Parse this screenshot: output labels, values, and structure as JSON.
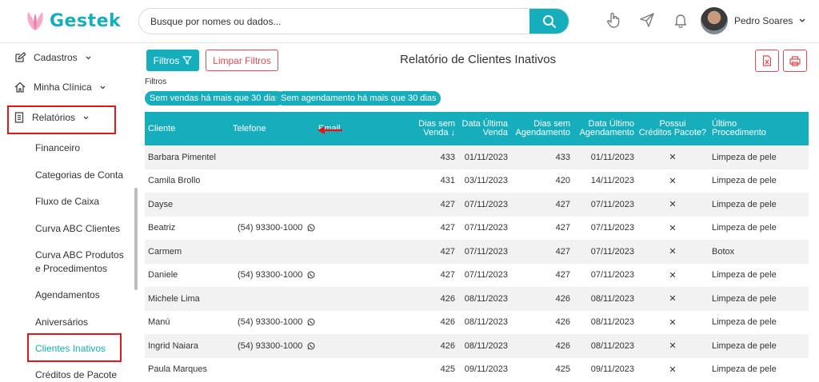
{
  "brand": {
    "name": "Gestek"
  },
  "search": {
    "placeholder": "Busque por nomes ou dados..."
  },
  "user": {
    "name": "Pedro Soares"
  },
  "colors": {
    "accent": "#16aebd",
    "danger": "#e04a55",
    "highlight": "#e01818"
  },
  "sidebar": {
    "cadastros": "Cadastros",
    "minha_clinica": "Minha Clínica",
    "relatorios": "Relatórios",
    "items": [
      "Financeiro",
      "Categorias de Conta",
      "Fluxo de Caixa",
      "Curva ABC Clientes",
      "Curva ABC Produtos e Procedimentos",
      "Agendamentos",
      "Aniversários",
      "Clientes Inativos",
      "Créditos de Pacote"
    ],
    "active_item": "Clientes Inativos"
  },
  "toolbar": {
    "filtros_label": "Filtros",
    "limpar_label": "Limpar Filtros",
    "title": "Relatório de Clientes Inativos"
  },
  "filters": {
    "label": "Filtros",
    "chips": [
      "Sem vendas há mais que 30 dias",
      "Sem agendamento há mais que 30 dias"
    ]
  },
  "table": {
    "headers": {
      "cliente": "Cliente",
      "telefone": "Telefone",
      "email": "Email",
      "dias_venda_1": "Dias sem",
      "dias_venda_2": "Venda",
      "data_venda_1": "Data Última",
      "data_venda_2": "Venda",
      "dias_agend_1": "Dias sem",
      "dias_agend_2": "Agendamento",
      "data_agend_1": "Data Último",
      "data_agend_2": "Agendamento",
      "creditos_1": "Possui",
      "creditos_2": "Créditos Pacote?",
      "proc_1": "Último",
      "proc_2": "Procedimento"
    },
    "rows": [
      {
        "cliente": "Barbara Pimentel",
        "telefone": "",
        "dias_venda": "433",
        "data_venda": "01/11/2023",
        "dias_agend": "433",
        "data_agend": "01/11/2023",
        "creditos": "✕",
        "procedimento": "Limpeza de pele"
      },
      {
        "cliente": "Camila Brollo",
        "telefone": "",
        "dias_venda": "431",
        "data_venda": "03/11/2023",
        "dias_agend": "420",
        "data_agend": "14/11/2023",
        "creditos": "✕",
        "procedimento": "Limpeza de pele"
      },
      {
        "cliente": "Dayse",
        "telefone": "",
        "dias_venda": "427",
        "data_venda": "07/11/2023",
        "dias_agend": "427",
        "data_agend": "07/11/2023",
        "creditos": "✕",
        "procedimento": "Limpeza de pele"
      },
      {
        "cliente": "Beatriz",
        "telefone": "(54) 93300-1000",
        "dias_venda": "427",
        "data_venda": "07/11/2023",
        "dias_agend": "427",
        "data_agend": "07/11/2023",
        "creditos": "✕",
        "procedimento": "Limpeza de pele"
      },
      {
        "cliente": "Carmem",
        "telefone": "",
        "dias_venda": "427",
        "data_venda": "07/11/2023",
        "dias_agend": "427",
        "data_agend": "07/11/2023",
        "creditos": "✕",
        "procedimento": "Botox"
      },
      {
        "cliente": "Daniele",
        "telefone": "(54) 93300-1000",
        "dias_venda": "427",
        "data_venda": "07/11/2023",
        "dias_agend": "427",
        "data_agend": "07/11/2023",
        "creditos": "✕",
        "procedimento": "Limpeza de pele"
      },
      {
        "cliente": "Michele Lima",
        "telefone": "",
        "dias_venda": "426",
        "data_venda": "08/11/2023",
        "dias_agend": "426",
        "data_agend": "08/11/2023",
        "creditos": "✕",
        "procedimento": "Limpeza de pele"
      },
      {
        "cliente": "Manú",
        "telefone": "(54) 93300-1000",
        "dias_venda": "426",
        "data_venda": "08/11/2023",
        "dias_agend": "426",
        "data_agend": "08/11/2023",
        "creditos": "✕",
        "procedimento": "Limpeza de pele"
      },
      {
        "cliente": "Ingrid Naiara",
        "telefone": "(54) 93300-1000",
        "dias_venda": "426",
        "data_venda": "08/11/2023",
        "dias_agend": "426",
        "data_agend": "08/11/2023",
        "creditos": "✕",
        "procedimento": "Limpeza de pele"
      },
      {
        "cliente": "Paula Marques",
        "telefone": "",
        "dias_venda": "425",
        "data_venda": "09/11/2023",
        "dias_agend": "425",
        "data_agend": "09/11/2023",
        "creditos": "✕",
        "procedimento": "Limpeza de pele"
      }
    ]
  }
}
